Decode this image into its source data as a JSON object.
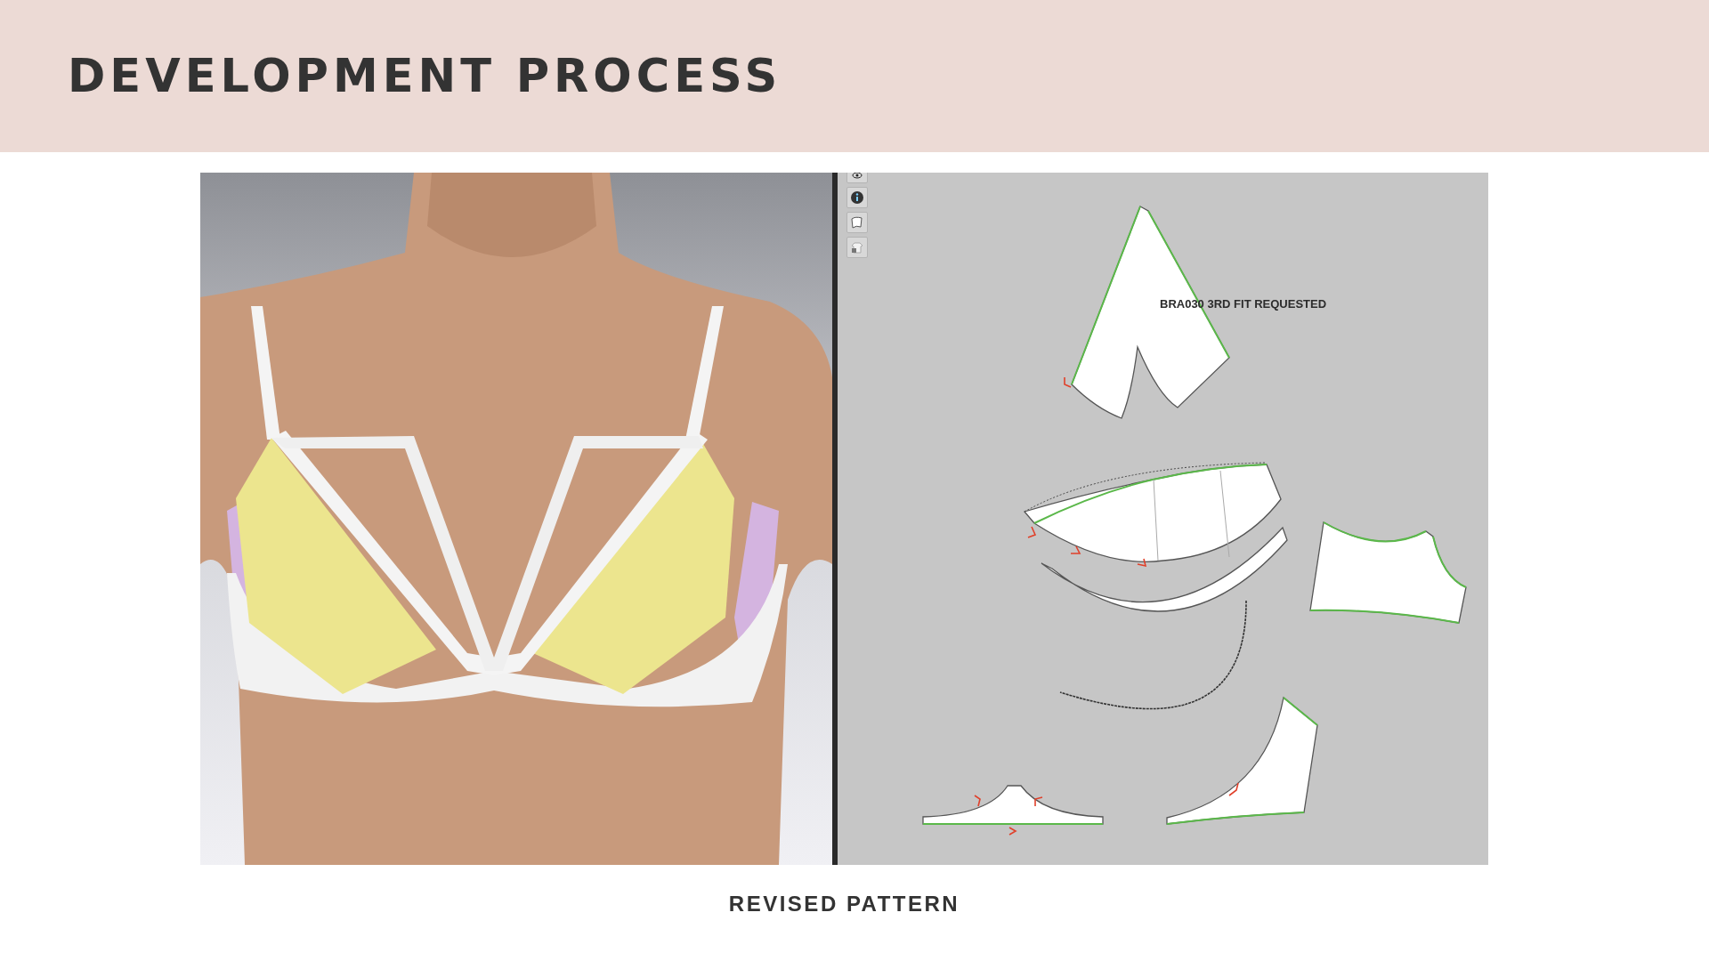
{
  "slide": {
    "title": "DEVELOPMENT PROCESS",
    "caption": "REVISED PATTERN"
  },
  "pattern_window": {
    "label": "BRA030 3RD FIT REQUESTED"
  }
}
